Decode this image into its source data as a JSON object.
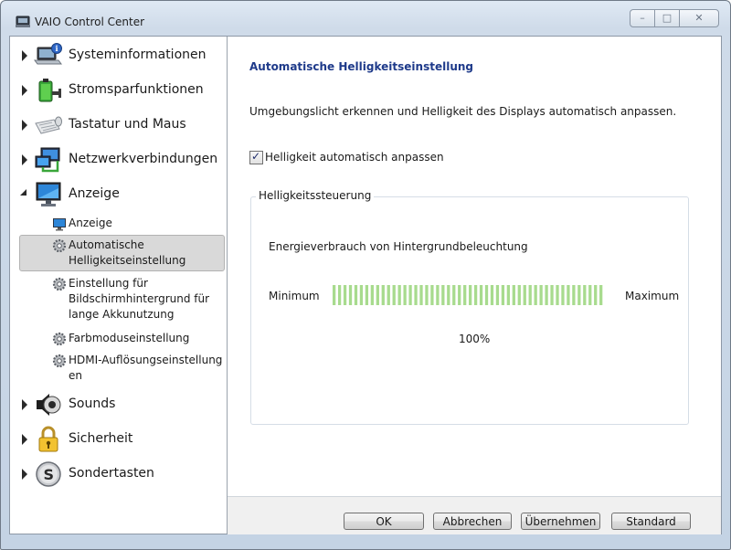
{
  "window": {
    "title": "VAIO Control Center"
  },
  "sidebar": {
    "items": [
      {
        "label": "Systeminformationen",
        "icon": "laptop-info-icon"
      },
      {
        "label": "Stromsparfunktionen",
        "icon": "battery-plug-icon"
      },
      {
        "label": "Tastatur und Maus",
        "icon": "keyboard-mouse-icon"
      },
      {
        "label": "Netzwerkverbindungen",
        "icon": "network-monitors-icon"
      },
      {
        "label": "Anzeige",
        "icon": "display-monitor-icon"
      },
      {
        "label": "Sounds",
        "icon": "speaker-icon"
      },
      {
        "label": "Sicherheit",
        "icon": "padlock-icon"
      },
      {
        "label": "Sondertasten",
        "icon": "s-key-icon"
      }
    ],
    "sub_items": [
      {
        "label": "Anzeige",
        "icon": "monitor-small-icon"
      },
      {
        "label": "Automatische Helligkeitseinstellung",
        "icon": "gear-icon"
      },
      {
        "label": "Einstellung für Bildschirmhintergrund für lange Akkunutzung",
        "icon": "gear-icon"
      },
      {
        "label": "Farbmoduseinstellung",
        "icon": "gear-icon"
      },
      {
        "label": "HDMI-Auflösungseinstellung en",
        "icon": "gear-icon"
      }
    ]
  },
  "content": {
    "title": "Automatische Helligkeitseinstellung",
    "description": "Umgebungslicht erkennen und Helligkeit des Displays automatisch anpassen.",
    "checkbox_label": "Helligkeit automatisch anpassen",
    "checkbox_checked": true,
    "group_title": "Helligkeitssteuerung",
    "group_subtitle": "Energieverbrauch von Hintergrundbeleuchtung",
    "min_label": "Minimum",
    "max_label": "Maximum",
    "meter_level": 1.0,
    "percent": "100%",
    "meter_color": "#a8db8e"
  },
  "footer": {
    "ok": "OK",
    "cancel": "Abbrechen",
    "apply": "Übernehmen",
    "default": "Standard"
  }
}
